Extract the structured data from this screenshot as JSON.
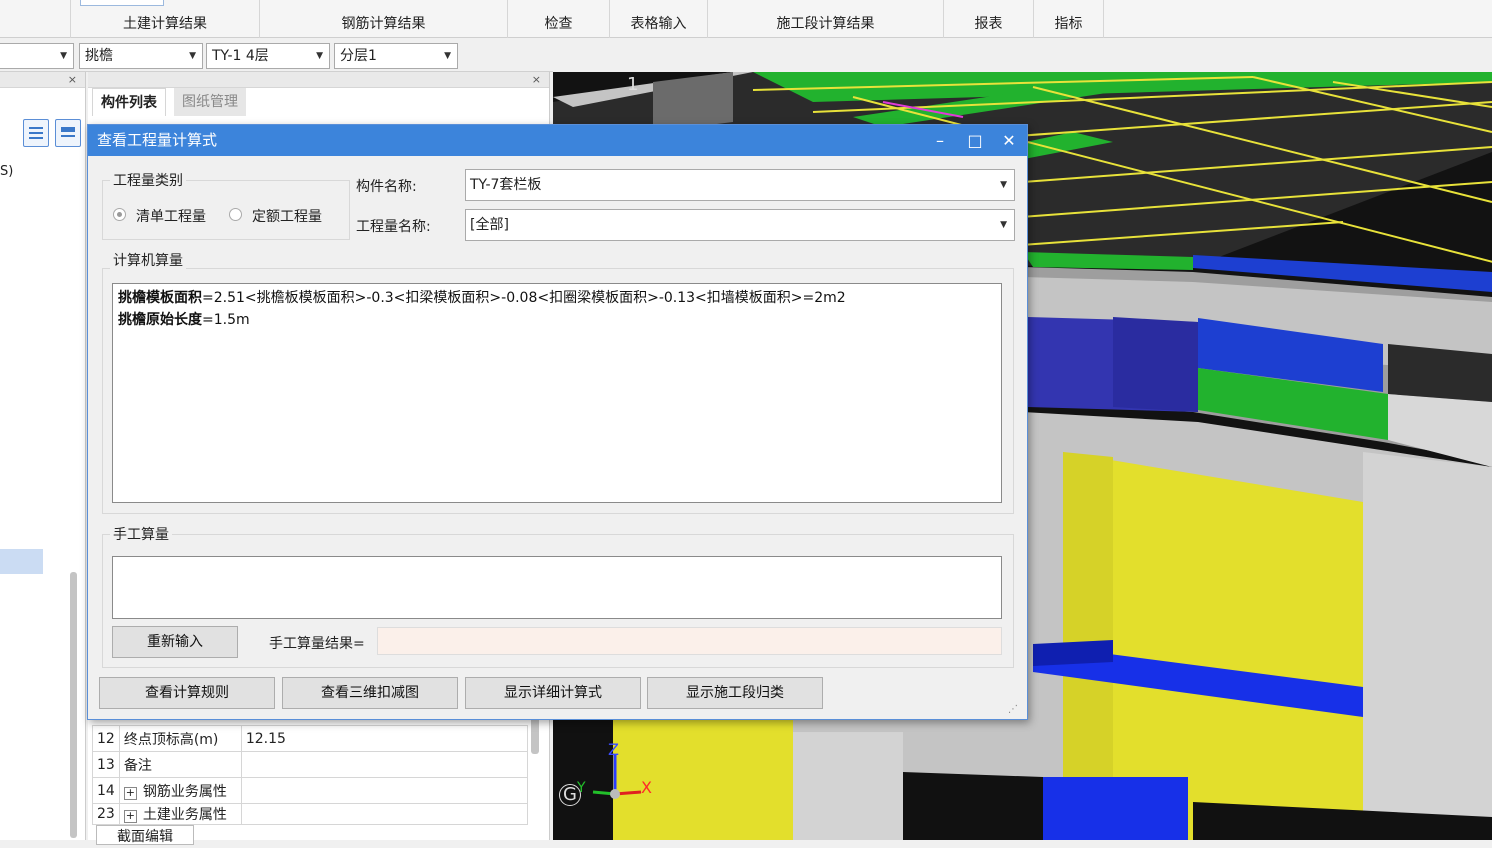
{
  "ribbon": {
    "tabs": [
      "土建计算结果",
      "钢筋计算结果",
      "检查",
      "表格输入",
      "施工段计算结果",
      "报表",
      "指标"
    ]
  },
  "filters": {
    "combo1": "",
    "combo2": "挑檐",
    "combo3": "TY-1 4层",
    "combo4": "分层1"
  },
  "left_panel": {
    "close": "×",
    "partial_text": "S)"
  },
  "mid_panel": {
    "close": "×",
    "tabs": [
      "构件列表",
      "图纸管理"
    ],
    "rows": [
      {
        "num": "12",
        "name": "终点顶标高(m)",
        "value": "12.15"
      },
      {
        "num": "13",
        "name": "备注",
        "value": ""
      },
      {
        "num": "14",
        "name": "钢筋业务属性",
        "value": "",
        "expand": "+"
      },
      {
        "num": "23",
        "name": "土建业务属性",
        "value": "",
        "expand": "+"
      }
    ],
    "bottom_tab": "截面编辑"
  },
  "dialog": {
    "title": "查看工程量计算式",
    "min": "–",
    "max": "□",
    "close": "✕",
    "quantity_type": {
      "legend": "工程量类别",
      "options": [
        "清单工程量",
        "定额工程量"
      ],
      "selected": "清单工程量"
    },
    "component_label": "构件名称:",
    "component_value": "TY-7套栏板",
    "quantity_label": "工程量名称:",
    "quantity_value": "[全部]",
    "computer_section": "计算机算量",
    "formula_lines": [
      {
        "label": "挑檐模板面积",
        "text": "=2.51<挑檐板模板面积>-0.3<扣梁模板面积>-0.08<扣圈梁模板面积>-0.13<扣墙模板面积>=2m2"
      },
      {
        "label": "挑檐原始长度",
        "text": "=1.5m"
      }
    ],
    "manual_section": "手工算量",
    "reinput": "重新输入",
    "manual_result_label": "手工算量结果=",
    "buttons": [
      "查看计算规则",
      "查看三维扣减图",
      "显示详细计算式",
      "显示施工段归类"
    ]
  },
  "viewport": {
    "axis_labels": {
      "z": "Z",
      "x": "X",
      "y": "Y",
      "g": "G",
      "top": "1"
    },
    "colors": {
      "green": "#22b22e",
      "blue": "#1730e8",
      "yellow": "#e3df2c",
      "gray": "#c4c4c4",
      "navy": "#3335b0",
      "line": "#e8e23a"
    }
  }
}
